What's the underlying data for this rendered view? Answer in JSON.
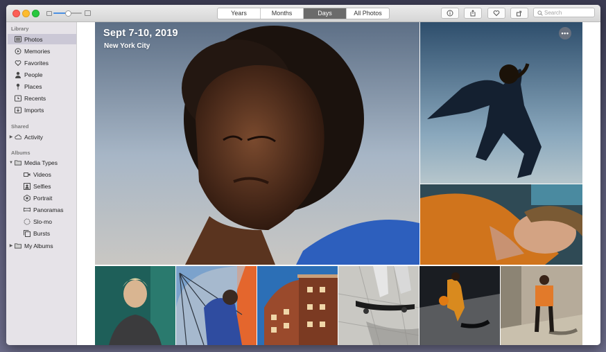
{
  "toolbar": {
    "zoom_level": 0.5,
    "tabs": [
      {
        "label": "Years",
        "active": false
      },
      {
        "label": "Months",
        "active": false
      },
      {
        "label": "Days",
        "active": true
      },
      {
        "label": "All Photos",
        "active": false
      }
    ],
    "buttons": [
      "info-icon",
      "share-icon",
      "heart-icon",
      "rotate-icon"
    ],
    "search_placeholder": "Search"
  },
  "sidebar": {
    "library_header": "Library",
    "library": [
      {
        "label": "Photos",
        "icon": "photos-icon",
        "selected": true
      },
      {
        "label": "Memories",
        "icon": "memories-icon"
      },
      {
        "label": "Favorites",
        "icon": "heart-icon"
      },
      {
        "label": "People",
        "icon": "person-icon"
      },
      {
        "label": "Places",
        "icon": "pin-icon"
      },
      {
        "label": "Recents",
        "icon": "clock-icon"
      },
      {
        "label": "Imports",
        "icon": "import-icon"
      }
    ],
    "shared_header": "Shared",
    "shared": [
      {
        "label": "Activity",
        "icon": "cloud-icon"
      }
    ],
    "albums_header": "Albums",
    "albums": [
      {
        "label": "Media Types",
        "icon": "folder-icon"
      },
      {
        "label": "Videos",
        "icon": "video-icon"
      },
      {
        "label": "Selfies",
        "icon": "selfie-icon"
      },
      {
        "label": "Portrait",
        "icon": "portrait-icon"
      },
      {
        "label": "Panoramas",
        "icon": "panorama-icon"
      },
      {
        "label": "Slo-mo",
        "icon": "slomo-icon"
      },
      {
        "label": "Bursts",
        "icon": "bursts-icon"
      },
      {
        "label": "My Albums",
        "icon": "folder-icon"
      }
    ]
  },
  "main": {
    "date_title": "Sept 7-10, 2019",
    "location": "New York City",
    "more_icon": "ellipsis-icon"
  },
  "colors": {
    "accent": "#4a90e2",
    "selected_row": "#cbc8d6",
    "active_tab": "#6b6b6b"
  }
}
